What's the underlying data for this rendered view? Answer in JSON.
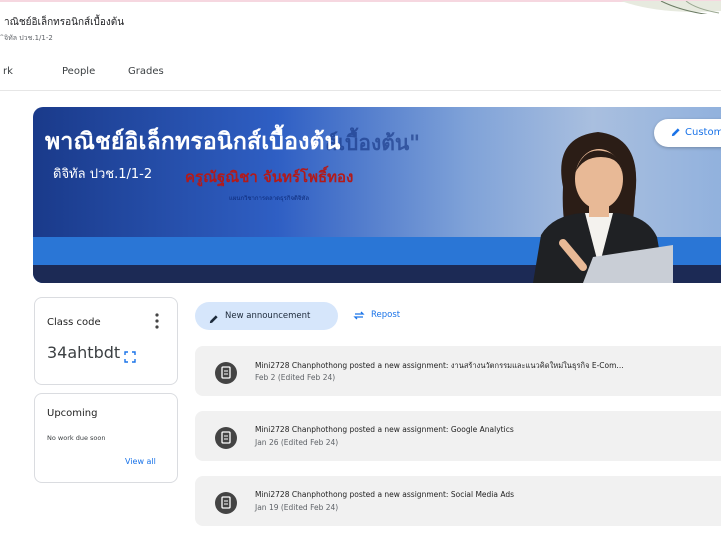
{
  "course": {
    "title": "าณิชย์อิเล็กทรอนิกส์เบื้องต้น",
    "subtitle": "ิจิทัล ปวช.1/1-2"
  },
  "tabs": [
    "rk",
    "People",
    "Grades"
  ],
  "banner": {
    "title": "พาณิชย์อิเล็กทรอนิกส์เบื้องต้น",
    "subtitle": "ดิจิทัล ปวช.1/1-2",
    "ghost_text": "ส์เบื้องต้น\"",
    "teacher": "ครูณัฐณิชา จันทร์โพธิ์ทอง",
    "department": "แผนกวิชาการตลาดธุรกิจดิจิทัล",
    "customize_label": "Custom"
  },
  "class_code": {
    "label": "Class code",
    "value": "34ahtbdt"
  },
  "upcoming": {
    "label": "Upcoming",
    "empty_text": "No work due soon",
    "view_all": "View all"
  },
  "actions": {
    "announce_label": "New announcement",
    "repost_label": "Repost"
  },
  "posts": [
    {
      "title": "Mini2728 Chanphothong posted a new assignment: งานสร้างนวัตกรรมและแนวคิดใหม่ในธุรกิจ E-Com...",
      "date": "Feb 2 (Edited Feb 24)"
    },
    {
      "title": "Mini2728 Chanphothong posted a new assignment: Google Analytics",
      "date": "Jan 26 (Edited Feb 24)"
    },
    {
      "title": "Mini2728 Chanphothong posted a new assignment: Social Media Ads",
      "date": "Jan 19 (Edited Feb 24)"
    }
  ],
  "colors": {
    "accent": "#1a73e8",
    "chip": "#d6e6fb",
    "post_bg": "#f1f1f1"
  }
}
